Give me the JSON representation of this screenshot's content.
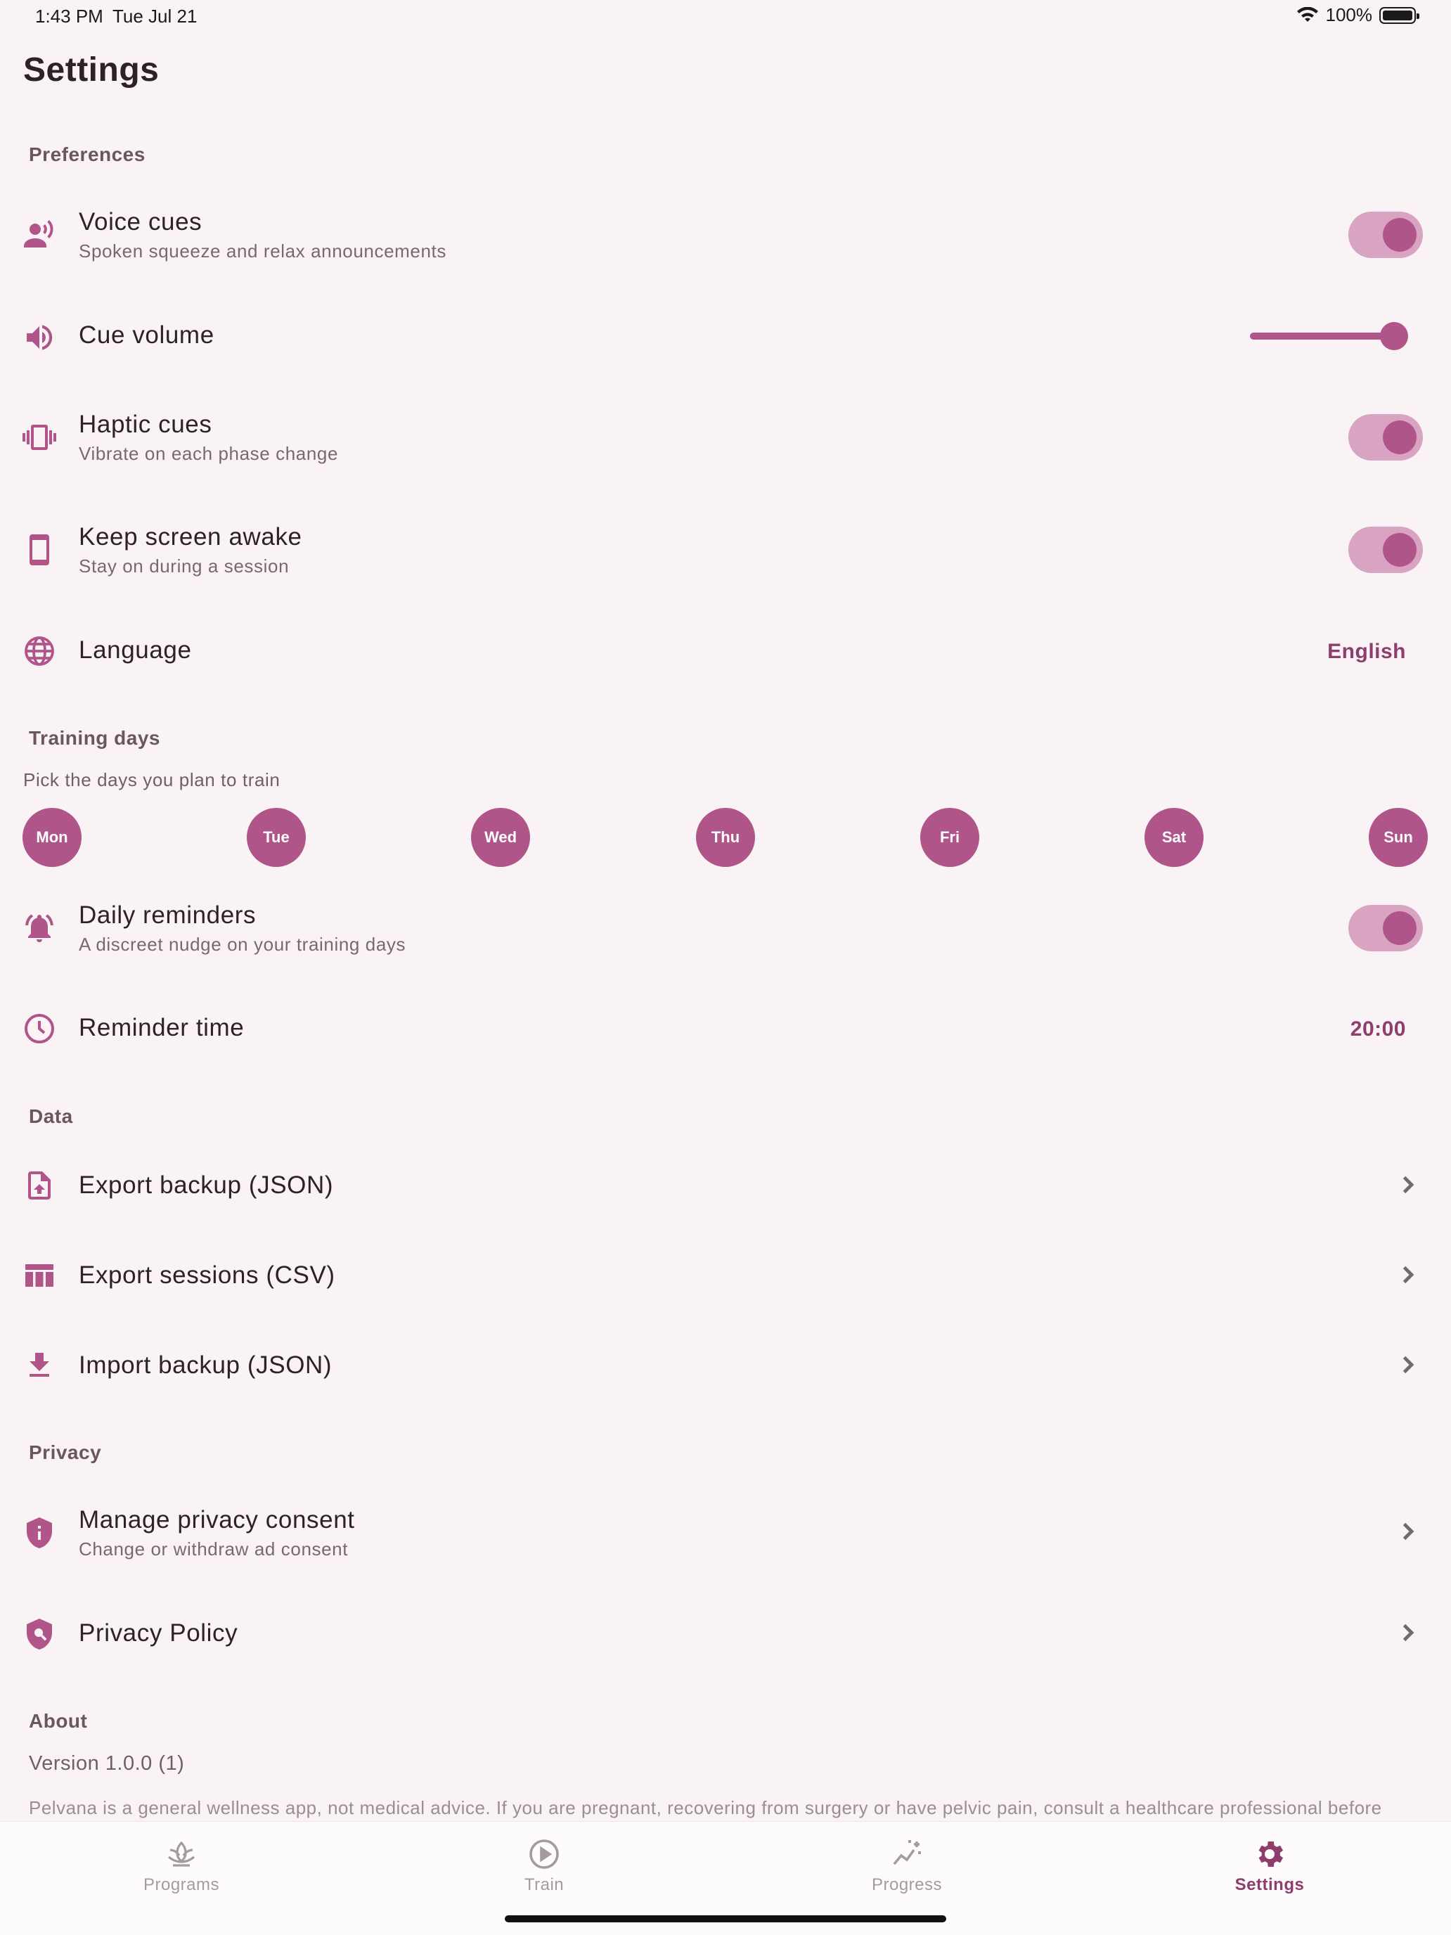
{
  "status_bar": {
    "time": "1:43 PM",
    "date": "Tue Jul 21",
    "battery": "100%"
  },
  "page_title": "Settings",
  "sections": {
    "preferences": "Preferences",
    "training_days": "Training days",
    "data": "Data",
    "privacy": "Privacy",
    "about": "About"
  },
  "preferences": {
    "voice_cues": {
      "title": "Voice cues",
      "subtitle": "Spoken squeeze and relax announcements",
      "enabled": true
    },
    "cue_volume": {
      "title": "Cue volume",
      "level": 0.9
    },
    "haptic_cues": {
      "title": "Haptic cues",
      "subtitle": "Vibrate on each phase change",
      "enabled": true
    },
    "keep_awake": {
      "title": "Keep screen awake",
      "subtitle": "Stay on during a session",
      "enabled": true
    },
    "language": {
      "title": "Language",
      "value": "English"
    }
  },
  "training_days": {
    "hint": "Pick the days you plan to train",
    "days": [
      "Mon",
      "Tue",
      "Wed",
      "Thu",
      "Fri",
      "Sat",
      "Sun"
    ],
    "daily_reminders": {
      "title": "Daily reminders",
      "subtitle": "A discreet nudge on your training days",
      "enabled": true
    },
    "reminder_time": {
      "title": "Reminder time",
      "value": "20:00"
    }
  },
  "data": {
    "export_backup": "Export backup (JSON)",
    "export_sessions": "Export sessions (CSV)",
    "import_backup": "Import backup (JSON)"
  },
  "privacy": {
    "manage_consent": {
      "title": "Manage privacy consent",
      "subtitle": "Change or withdraw ad consent"
    },
    "policy": "Privacy Policy"
  },
  "about": {
    "version": "Version 1.0.0 (1)",
    "disclaimer": "Pelvana is a general wellness app, not medical advice. If you are pregnant, recovering from surgery or have pelvic pain, consult a healthcare professional before"
  },
  "tabs": [
    {
      "label": "Programs",
      "icon": "lotus-icon",
      "active": false
    },
    {
      "label": "Train",
      "icon": "play-circle-icon",
      "active": false
    },
    {
      "label": "Progress",
      "icon": "sparkle-chart-icon",
      "active": false
    },
    {
      "label": "Settings",
      "icon": "gear-icon",
      "active": true
    }
  ],
  "colors": {
    "accent": "#b0558a",
    "accent_dark": "#8e3e6c",
    "toggle_track": "#d9a4c2",
    "background": "#f9f3f6"
  }
}
